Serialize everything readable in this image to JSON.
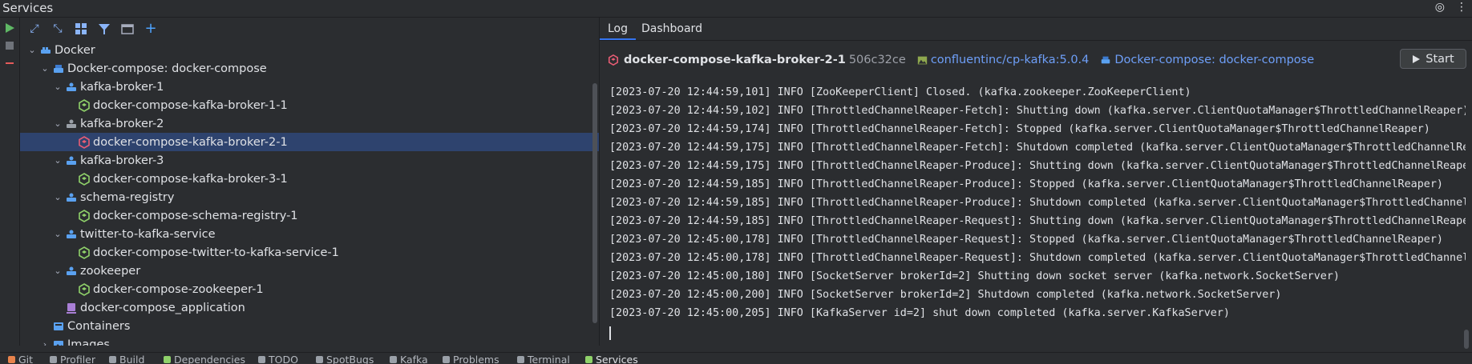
{
  "window": {
    "title": "Services"
  },
  "tree": {
    "items": [
      {
        "label": "Docker",
        "icon": "docker-icon",
        "level": 0,
        "expanded": true
      },
      {
        "label": "Docker-compose: docker-compose",
        "icon": "docker-compose-icon",
        "level": 1,
        "expanded": true
      },
      {
        "label": "kafka-broker-1",
        "icon": "service-icon",
        "level": 2,
        "expanded": true
      },
      {
        "label": "docker-compose-kafka-broker-1-1",
        "icon": "container-running-icon",
        "level": 3
      },
      {
        "label": "kafka-broker-2",
        "icon": "service-icon",
        "level": 2,
        "expanded": true
      },
      {
        "label": "docker-compose-kafka-broker-2-1",
        "icon": "container-stopped-icon",
        "level": 3,
        "selected": true
      },
      {
        "label": "kafka-broker-3",
        "icon": "service-icon",
        "level": 2,
        "expanded": true
      },
      {
        "label": "docker-compose-kafka-broker-3-1",
        "icon": "container-running-icon",
        "level": 3
      },
      {
        "label": "schema-registry",
        "icon": "service-icon",
        "level": 2,
        "expanded": true
      },
      {
        "label": "docker-compose-schema-registry-1",
        "icon": "container-running-icon",
        "level": 3
      },
      {
        "label": "twitter-to-kafka-service",
        "icon": "service-icon",
        "level": 2,
        "expanded": true
      },
      {
        "label": "docker-compose-twitter-to-kafka-service-1",
        "icon": "container-running-icon",
        "level": 3
      },
      {
        "label": "zookeeper",
        "icon": "service-icon",
        "level": 2,
        "expanded": true
      },
      {
        "label": "docker-compose-zookeeper-1",
        "icon": "container-running-icon",
        "level": 3
      },
      {
        "label": "docker-compose_application",
        "icon": "network-icon",
        "level": 2
      },
      {
        "label": "Containers",
        "icon": "containers-icon",
        "level": 1
      },
      {
        "label": "Images",
        "icon": "images-icon",
        "level": 1,
        "expanded": false
      }
    ]
  },
  "tabs": [
    {
      "label": "Log",
      "active": true
    },
    {
      "label": "Dashboard",
      "active": false
    }
  ],
  "container_info": {
    "name": "docker-compose-kafka-broker-2-1",
    "id": "506c32ce",
    "image": "confluentinc/cp-kafka:5.0.4",
    "compose": "Docker-compose: docker-compose",
    "start_label": "Start"
  },
  "log": {
    "lines": [
      "[2023-07-20 12:44:59,101] INFO [ZooKeeperClient] Closed. (kafka.zookeeper.ZooKeeperClient)",
      "[2023-07-20 12:44:59,102] INFO [ThrottledChannelReaper-Fetch]: Shutting down (kafka.server.ClientQuotaManager$ThrottledChannelReaper)",
      "[2023-07-20 12:44:59,174] INFO [ThrottledChannelReaper-Fetch]: Stopped (kafka.server.ClientQuotaManager$ThrottledChannelReaper)",
      "[2023-07-20 12:44:59,175] INFO [ThrottledChannelReaper-Fetch]: Shutdown completed (kafka.server.ClientQuotaManager$ThrottledChannelRea",
      "[2023-07-20 12:44:59,175] INFO [ThrottledChannelReaper-Produce]: Shutting down (kafka.server.ClientQuotaManager$ThrottledChannelReaper",
      "[2023-07-20 12:44:59,185] INFO [ThrottledChannelReaper-Produce]: Stopped (kafka.server.ClientQuotaManager$ThrottledChannelReaper)",
      "[2023-07-20 12:44:59,185] INFO [ThrottledChannelReaper-Produce]: Shutdown completed (kafka.server.ClientQuotaManager$ThrottledChannelR",
      "[2023-07-20 12:44:59,185] INFO [ThrottledChannelReaper-Request]: Shutting down (kafka.server.ClientQuotaManager$ThrottledChannelReaper",
      "[2023-07-20 12:45:00,178] INFO [ThrottledChannelReaper-Request]: Stopped (kafka.server.ClientQuotaManager$ThrottledChannelReaper)",
      "[2023-07-20 12:45:00,178] INFO [ThrottledChannelReaper-Request]: Shutdown completed (kafka.server.ClientQuotaManager$ThrottledChannelR",
      "[2023-07-20 12:45:00,180] INFO [SocketServer brokerId=2] Shutting down socket server (kafka.network.SocketServer)",
      "[2023-07-20 12:45:00,200] INFO [SocketServer brokerId=2] Shutdown completed (kafka.network.SocketServer)",
      "[2023-07-20 12:45:00,205] INFO [KafkaServer id=2] shut down completed (kafka.server.KafkaServer)"
    ]
  },
  "statusbar": {
    "items": [
      {
        "label": "Git",
        "active": false
      },
      {
        "label": "Profiler",
        "active": false
      },
      {
        "label": "Build",
        "active": false
      },
      {
        "label": "Dependencies",
        "active": false
      },
      {
        "label": "TODO",
        "active": false
      },
      {
        "label": "SpotBugs",
        "active": false
      },
      {
        "label": "Kafka",
        "active": false
      },
      {
        "label": "Problems",
        "active": false
      },
      {
        "label": "Terminal",
        "active": false
      },
      {
        "label": "Services",
        "active": true
      }
    ]
  },
  "colors": {
    "accent": "#3574f0",
    "running": "#8fd16a",
    "stopped": "#e85d75",
    "docker_blue": "#5aa1f0",
    "network_purple": "#a97fd6",
    "link": "#6e9ff8"
  }
}
